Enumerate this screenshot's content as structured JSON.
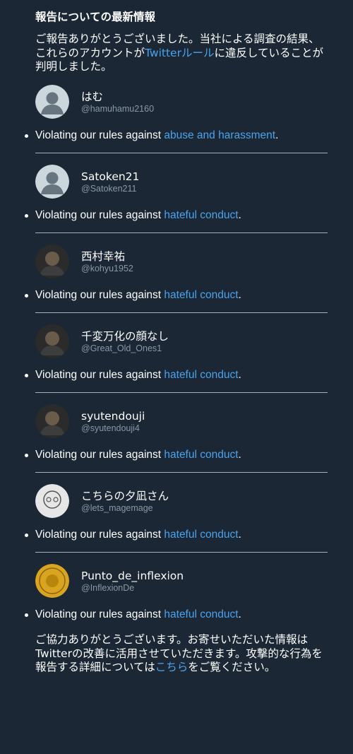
{
  "header": {
    "title": "報告についての最新情報",
    "intro_before": "ご報告ありがとうございました。当社による調査の結果、これらのアカウントが",
    "intro_link": "Twitterルール",
    "intro_after": "に違反していることが判明しました。"
  },
  "violation_prefix": "Violating our rules against ",
  "accounts": [
    {
      "name": "はむ",
      "handle": "@hamuhamu2160",
      "rule": "abuse and harassment",
      "avatar": "default-avatar"
    },
    {
      "name": "Satoken21",
      "handle": "@Satoken211",
      "rule": "hateful conduct",
      "avatar": "default-avatar"
    },
    {
      "name": "西村幸祐",
      "handle": "@kohyu1952",
      "rule": "hateful conduct",
      "avatar": "photo-avatar"
    },
    {
      "name": "千変万化の顔なし",
      "handle": "@Great_Old_Ones1",
      "rule": "hateful conduct",
      "avatar": "photo-avatar"
    },
    {
      "name": "syutendouji",
      "handle": "@syutendouji4",
      "rule": "hateful conduct",
      "avatar": "photo-avatar"
    },
    {
      "name": "こちらの夕凪さん",
      "handle": "@lets_magemage",
      "rule": "hateful conduct",
      "avatar": "drawing-avatar"
    },
    {
      "name": "Punto_de_inflexion",
      "handle": "@InflexionDe",
      "rule": "hateful conduct",
      "avatar": "coin-avatar"
    }
  ],
  "footer": {
    "text_before": "ご協力ありがとうございます。お寄せいただいた情報はTwitterの改善に活用させていただきます。攻撃的な行為を報告する詳細については",
    "link": "こちら",
    "text_after": "をご覧ください。"
  },
  "colors": {
    "background": "#1b2734",
    "link": "#4aa3ec",
    "muted": "#8899a6"
  }
}
